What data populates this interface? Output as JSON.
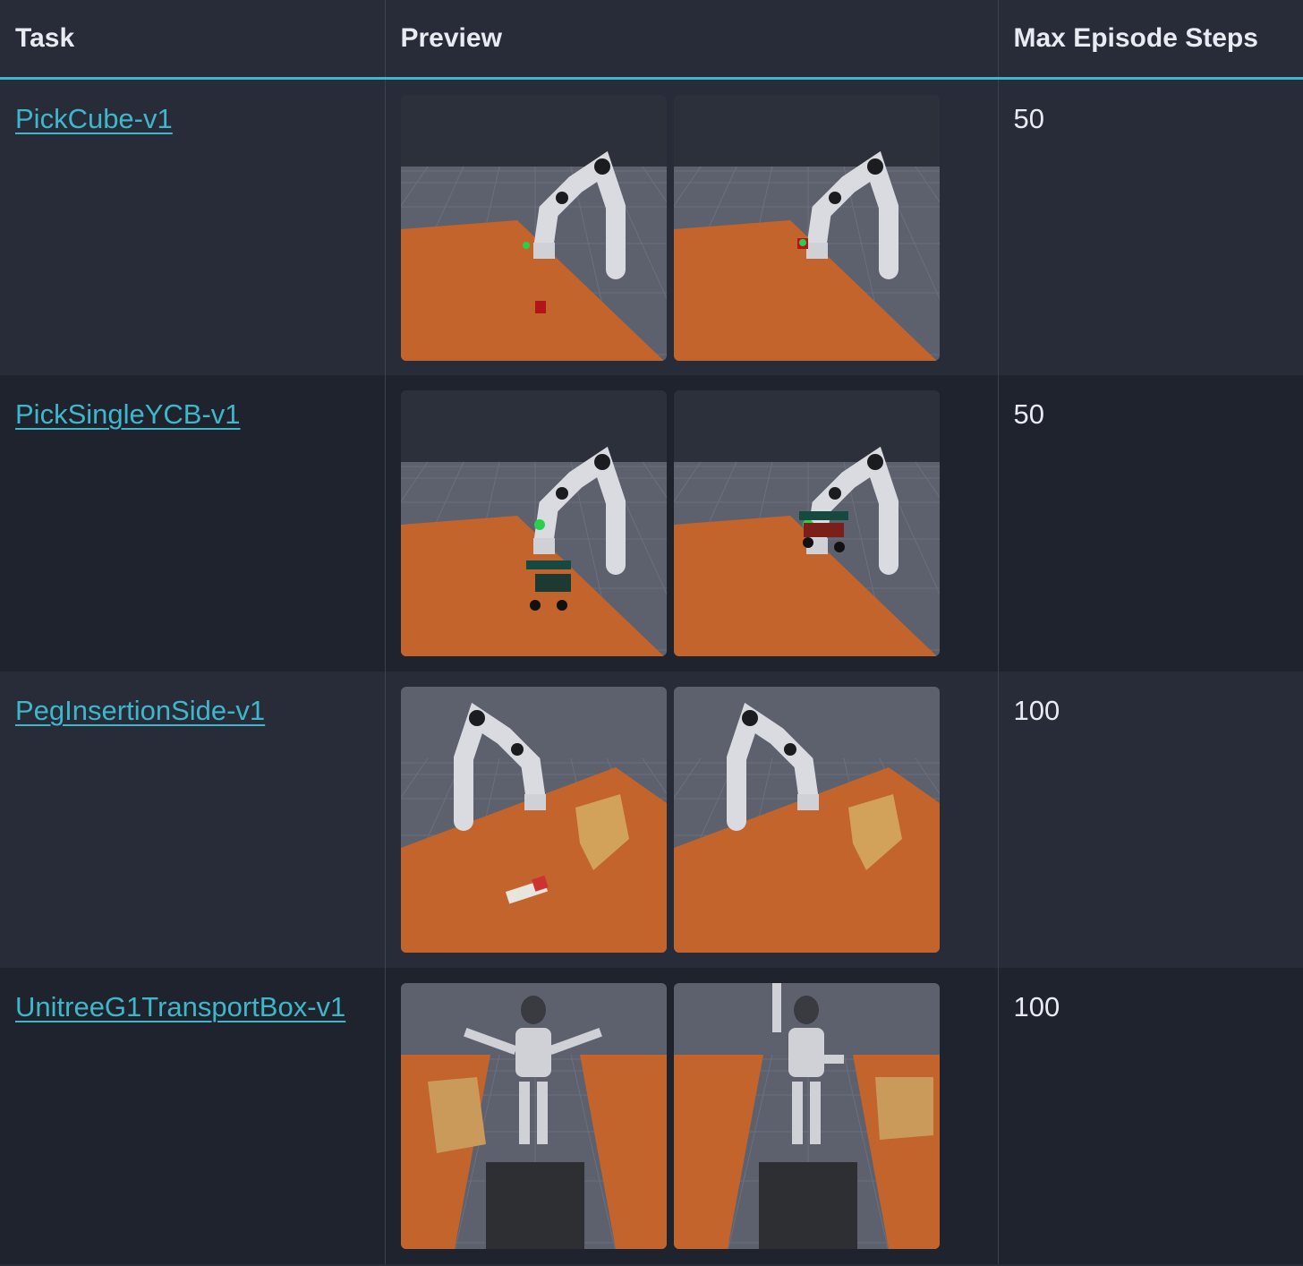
{
  "header": {
    "task": "Task",
    "preview": "Preview",
    "steps": "Max Episode Steps"
  },
  "rows": [
    {
      "task": "PickCube-v1",
      "steps": "50",
      "scene": "arm-cube"
    },
    {
      "task": "PickSingleYCB-v1",
      "steps": "50",
      "scene": "arm-ycb"
    },
    {
      "task": "PegInsertionSide-v1",
      "steps": "100",
      "scene": "arm-peg"
    },
    {
      "task": "UnitreeG1TransportBox-v1",
      "steps": "100",
      "scene": "humanoid-box"
    }
  ],
  "colors": {
    "accent": "#3fb7cb",
    "table_wood": "#c2642c",
    "floor": "#5c616d"
  }
}
